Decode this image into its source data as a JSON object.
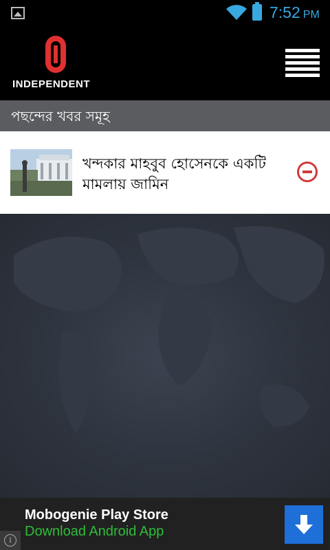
{
  "status_bar": {
    "time": "7:52",
    "ampm": "PM",
    "icons": [
      "gallery-icon",
      "wifi-icon",
      "battery-icon"
    ],
    "accent_color": "#38a8e0"
  },
  "header": {
    "logo_text": "INDEPENDENT",
    "logo_color": "#e03030",
    "menu_icon": "hamburger-menu-icon"
  },
  "section": {
    "title": "পছন্দের খবর সমূহ"
  },
  "favorites": [
    {
      "title": "খন্দকার মাহবুব হোসেনকে একটি মামলায় জামিন",
      "thumbnail_icon": "news-thumbnail",
      "action_icon": "remove-icon",
      "action_color": "#d03a3a"
    }
  ],
  "ad": {
    "title": "Mobogenie Play Store",
    "subtitle": "Download Android App",
    "subtitle_color": "#2fbd3a",
    "button_color": "#1e6fd8",
    "button_icon": "download-arrow-icon",
    "info_icon": "info-icon"
  }
}
